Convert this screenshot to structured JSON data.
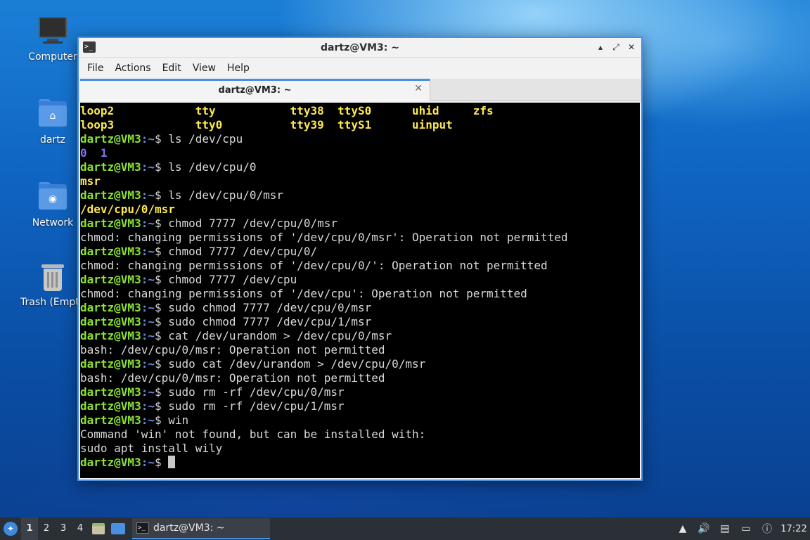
{
  "desktop": {
    "icons": [
      {
        "label": "Computer",
        "icon": "computer-icon"
      },
      {
        "label": "dartz",
        "icon": "home-folder-icon"
      },
      {
        "label": "Network",
        "icon": "network-folder-icon"
      },
      {
        "label": "Trash (Empty)",
        "icon": "trash-icon"
      }
    ]
  },
  "window": {
    "title": "dartz@VM3: ~",
    "controls": {
      "minimize": "▴",
      "maximize": "⤢",
      "close": "✕"
    },
    "menu": [
      "File",
      "Actions",
      "Edit",
      "View",
      "Help"
    ],
    "tab": {
      "label": "dartz@VM3: ~",
      "close": "✕"
    }
  },
  "terminal": {
    "user": "dartz@VM3",
    "path": ":~",
    "prompt_end": "$ ",
    "dev_listing": [
      [
        "loop2",
        "tty",
        "tty38",
        "ttyS0",
        "uhid",
        "zfs"
      ],
      [
        "loop3",
        "tty0",
        "tty39",
        "ttyS1",
        "uinput",
        ""
      ]
    ],
    "lines": [
      {
        "type": "cmd",
        "text": "ls /dev/cpu"
      },
      {
        "type": "cpu_dirs",
        "a": "0",
        "b": "1"
      },
      {
        "type": "cmd",
        "text": "ls /dev/cpu/0"
      },
      {
        "type": "yellow",
        "text": "msr"
      },
      {
        "type": "cmd",
        "text": "ls /dev/cpu/0/msr"
      },
      {
        "type": "yellow",
        "text": "/dev/cpu/0/msr"
      },
      {
        "type": "cmd",
        "text": "chmod 7777 /dev/cpu/0/msr"
      },
      {
        "type": "out",
        "text": "chmod: changing permissions of '/dev/cpu/0/msr': Operation not permitted"
      },
      {
        "type": "cmd",
        "text": "chmod 7777 /dev/cpu/0/"
      },
      {
        "type": "out",
        "text": "chmod: changing permissions of '/dev/cpu/0/': Operation not permitted"
      },
      {
        "type": "cmd",
        "text": "chmod 7777 /dev/cpu"
      },
      {
        "type": "out",
        "text": "chmod: changing permissions of '/dev/cpu': Operation not permitted"
      },
      {
        "type": "cmd",
        "text": "sudo chmod 7777 /dev/cpu/0/msr"
      },
      {
        "type": "cmd",
        "text": "sudo chmod 7777 /dev/cpu/1/msr"
      },
      {
        "type": "cmd",
        "text": "cat /dev/urandom > /dev/cpu/0/msr"
      },
      {
        "type": "out",
        "text": "bash: /dev/cpu/0/msr: Operation not permitted"
      },
      {
        "type": "cmd",
        "text": "sudo cat /dev/urandom > /dev/cpu/0/msr"
      },
      {
        "type": "out",
        "text": "bash: /dev/cpu/0/msr: Operation not permitted"
      },
      {
        "type": "cmd",
        "text": "sudo rm -rf /dev/cpu/0/msr"
      },
      {
        "type": "cmd",
        "text": "sudo rm -rf /dev/cpu/1/msr"
      },
      {
        "type": "cmd",
        "text": "win"
      },
      {
        "type": "out",
        "text": "Command 'win' not found, but can be installed with:"
      },
      {
        "type": "out",
        "text": "sudo apt install wily"
      },
      {
        "type": "cmd_cursor",
        "text": ""
      }
    ]
  },
  "taskbar": {
    "workspaces": [
      "1",
      "2",
      "3",
      "4"
    ],
    "active_workspace": "1",
    "task_label": "dartz@VM3: ~",
    "tray": {
      "volume": "🔊",
      "clock": "17:22"
    }
  }
}
